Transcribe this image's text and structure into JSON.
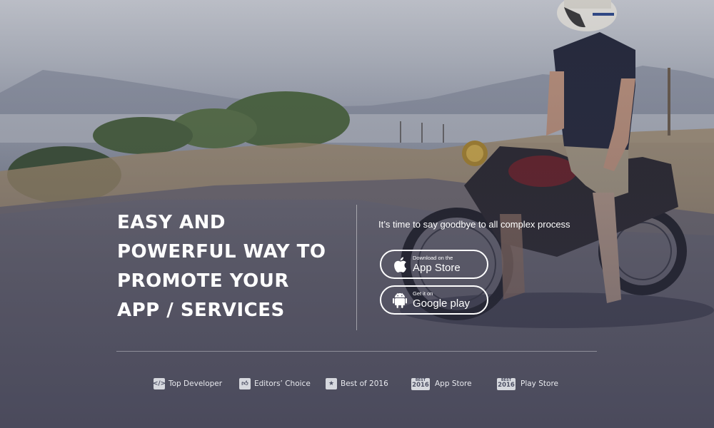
{
  "headline": {
    "lines": [
      "EASY AND",
      "POWERFUL WAY TO",
      "PROMOTE YOUR",
      "APP / SERVICES"
    ]
  },
  "tagline": "It’s time to say goodbye to all complex process",
  "app_store_button": {
    "small": "Download on the",
    "big": "App Store",
    "icon": "apple-icon"
  },
  "google_play_button": {
    "small": "Get it on",
    "big": "Google play",
    "icon": "android-icon"
  },
  "awards": [
    {
      "label": "Top Developer",
      "icon": "code-icon"
    },
    {
      "label": "Editors’ Choice",
      "icon": "thumbs-up-icon"
    },
    {
      "label": "Best of 2016",
      "icon": "star-icon"
    },
    {
      "label": "App Store",
      "badge_top": "BEST",
      "badge_bottom": "2016"
    },
    {
      "label": "Play Store",
      "badge_top": "BEST",
      "badge_bottom": "2016"
    }
  ]
}
